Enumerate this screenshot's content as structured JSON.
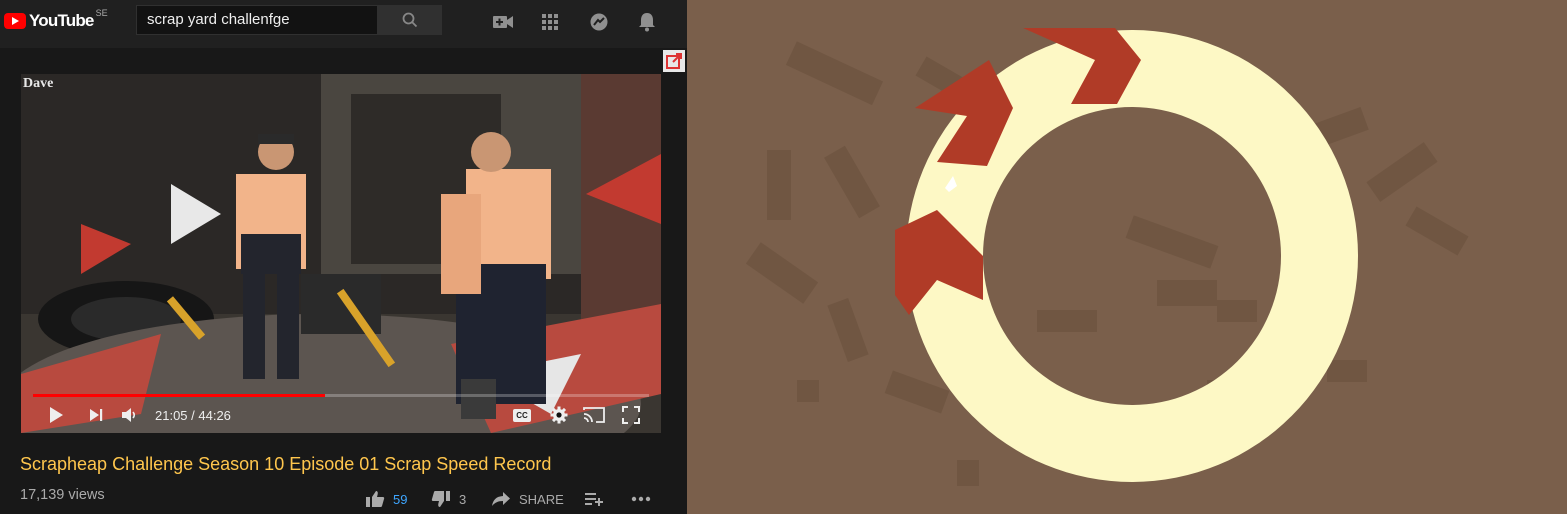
{
  "browser_app": {
    "logo": "YouTube",
    "country": "SE",
    "search": {
      "value": "scrap yard challenfge",
      "placeholder": "Search"
    },
    "icons": [
      "search-icon",
      "create-video-icon",
      "apps-grid-icon",
      "messages-icon",
      "notifications-bell-icon",
      "miniplayer-icon"
    ]
  },
  "player": {
    "watermark": "Dave",
    "time": "21:05 / 44:26",
    "progress": 0.4744,
    "controls": [
      "play-icon",
      "next-icon",
      "volume-icon",
      "captions-icon",
      "settings-gear-icon",
      "cast-icon",
      "fullscreen-icon"
    ],
    "captions_label": "CC"
  },
  "video": {
    "title": "Scrapheap Challenge Season 10 Episode 01 Scrap Speed Record",
    "views": "17,139 views",
    "likes": "59",
    "dislikes": "3",
    "share_label": "SHARE",
    "icons": [
      "thumbs-up-icon",
      "thumbs-down-icon",
      "share-icon",
      "add-to-playlist-icon",
      "more-icon"
    ]
  },
  "game": {
    "ring_progress": 0.22,
    "colors": {
      "background": "#7a5f4b",
      "ring": "#fdf8c5",
      "arrows": "#b03b27"
    }
  },
  "colors": {
    "masthead": "#202020",
    "page": "#181818",
    "title": "#ffc64d",
    "progress": "#ff0000",
    "like_count": "#3ea6ff"
  }
}
